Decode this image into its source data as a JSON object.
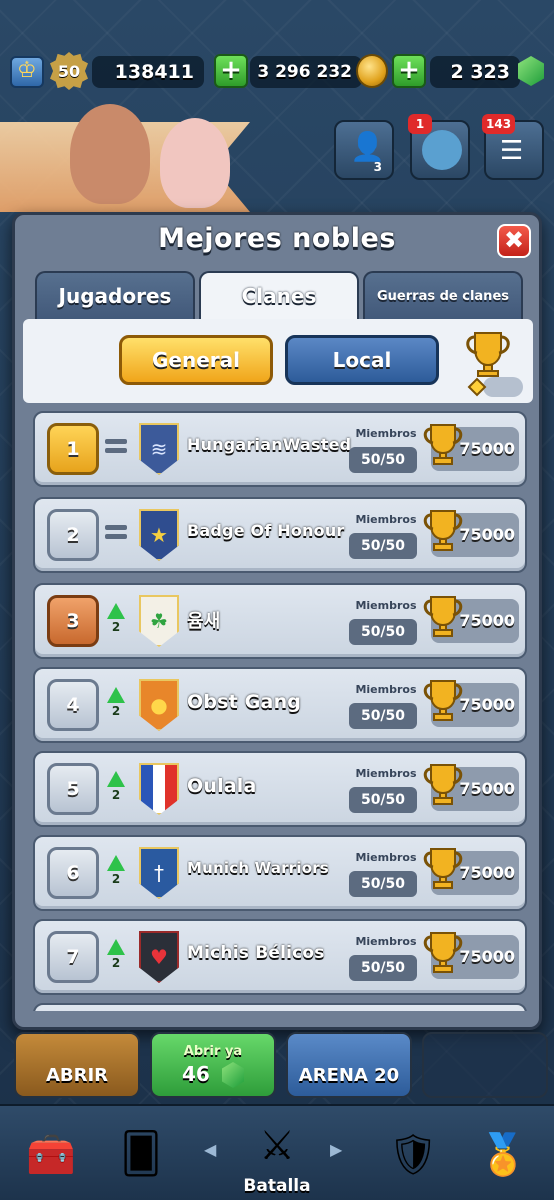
{
  "top_bar": {
    "level": "50",
    "trophies_total": "138411",
    "gold": "3 296 232",
    "gems": "2 323",
    "plus_symbol": "+"
  },
  "top_buttons": {
    "friends_count": "3",
    "clan_notif": "1",
    "menu_notif": "143"
  },
  "modal": {
    "title": "Mejores nobles",
    "close_symbol": "✖",
    "tabs": [
      {
        "label": "Jugadores",
        "active": false
      },
      {
        "label": "Clanes",
        "active": true
      },
      {
        "label": "Guerras de clanes",
        "active": false
      }
    ],
    "filters": {
      "general_label": "General",
      "local_label": "Local",
      "active": "General"
    },
    "members_label": "Miembros",
    "rows": [
      {
        "rank": "1",
        "change": "=",
        "up": "",
        "name": "HungarianWasted",
        "members": "50/50",
        "trophies": "75000",
        "badge_color": "#3c5a9a",
        "badge_symbol": "≋",
        "rank_style": "gold"
      },
      {
        "rank": "2",
        "change": "=",
        "up": "",
        "name": "Badge Of Honour",
        "members": "50/50",
        "trophies": "75000",
        "badge_color": "#2f4d8f",
        "badge_symbol": "★",
        "rank_style": "silver"
      },
      {
        "rank": "3",
        "change": "up",
        "up": "2",
        "name": "윰새",
        "members": "50/50",
        "trophies": "75000",
        "badge_color": "#f3f0e6",
        "badge_symbol": "☘",
        "rank_style": "bronze"
      },
      {
        "rank": "4",
        "change": "up",
        "up": "2",
        "name": "Obst Gang",
        "members": "50/50",
        "trophies": "75000",
        "badge_color": "#e8862a",
        "badge_symbol": "●",
        "rank_style": "silver"
      },
      {
        "rank": "5",
        "change": "up",
        "up": "2",
        "name": "Oulala",
        "members": "50/50",
        "trophies": "75000",
        "badge_color": "#ffffff",
        "badge_symbol": "▮",
        "rank_style": "silver"
      },
      {
        "rank": "6",
        "change": "up",
        "up": "2",
        "name": "Munich Warriors",
        "members": "50/50",
        "trophies": "75000",
        "badge_color": "#2a5aa0",
        "badge_symbol": "†",
        "rank_style": "silver"
      },
      {
        "rank": "7",
        "change": "up",
        "up": "2",
        "name": "Michis Bélicos",
        "members": "50/50",
        "trophies": "75000",
        "badge_color": "#2b2f38",
        "badge_symbol": "♥",
        "rank_style": "silver"
      }
    ]
  },
  "chests": [
    {
      "label": "ABRIR",
      "sublabel": ""
    },
    {
      "label": "46",
      "sublabel": "Abrir ya"
    },
    {
      "label": "ARENA 20",
      "sublabel": ""
    }
  ],
  "bottom_nav": {
    "battle_label": "Batalla"
  }
}
